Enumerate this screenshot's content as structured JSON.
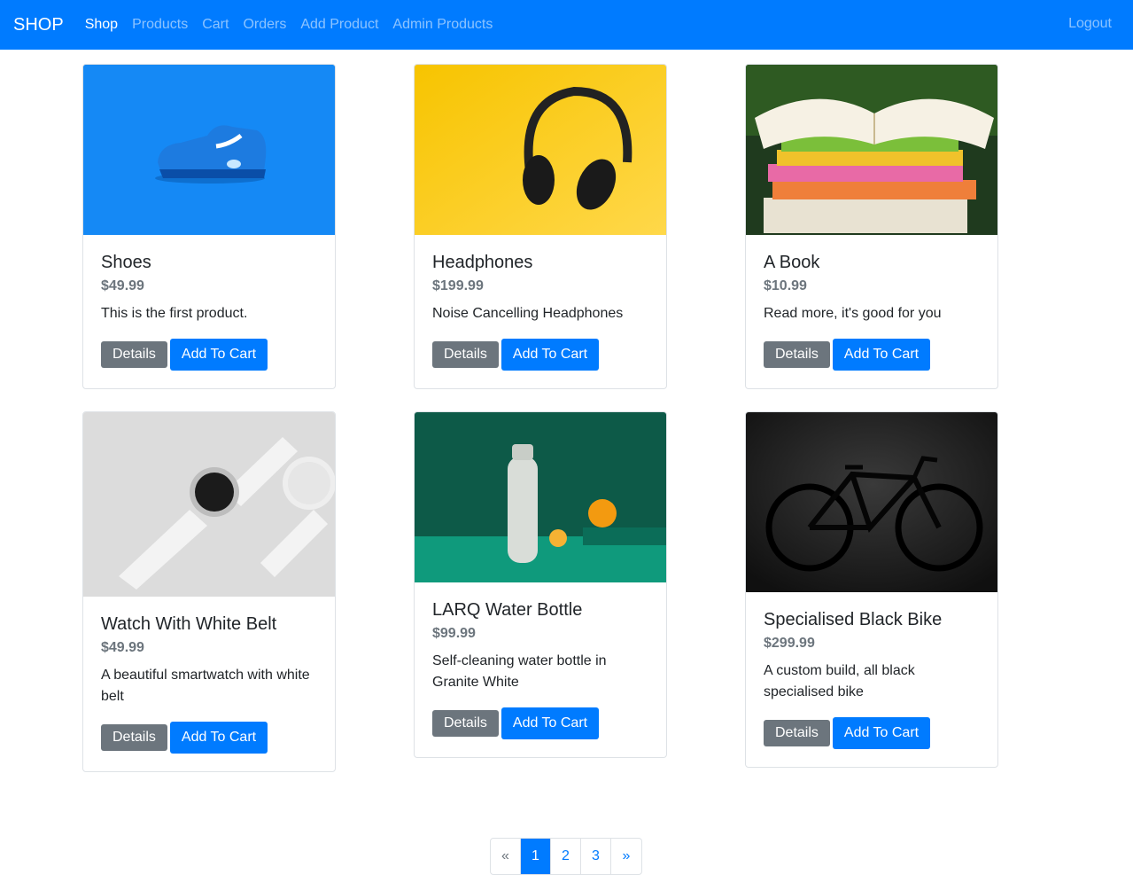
{
  "navbar": {
    "brand": "SHOP",
    "links": [
      {
        "label": "Shop",
        "active": true
      },
      {
        "label": "Products"
      },
      {
        "label": "Cart"
      },
      {
        "label": "Orders"
      },
      {
        "label": "Add Product"
      },
      {
        "label": "Admin Products"
      }
    ],
    "logout": "Logout"
  },
  "products": [
    {
      "title": "Shoes",
      "price": "$49.99",
      "description": "This is the first product.",
      "image": "shoe-image"
    },
    {
      "title": "Headphones",
      "price": "$199.99",
      "description": "Noise Cancelling Headphones",
      "image": "headphones-image"
    },
    {
      "title": "A Book",
      "price": "$10.99",
      "description": "Read more, it's good for you",
      "image": "book-image"
    },
    {
      "title": "Watch With White Belt",
      "price": "$49.99",
      "description": "A beautiful smartwatch with white belt",
      "image": "watch-image"
    },
    {
      "title": "LARQ Water Bottle",
      "price": "$99.99",
      "description": "Self-cleaning water bottle in Granite White",
      "image": "bottle-image"
    },
    {
      "title": "Specialised Black Bike",
      "price": "$299.99",
      "description": "A custom build, all black specialised bike",
      "image": "bike-image"
    }
  ],
  "buttons": {
    "details": "Details",
    "add_to_cart": "Add To Cart"
  },
  "pagination": {
    "prev": "«",
    "pages": [
      "1",
      "2",
      "3"
    ],
    "next": "»",
    "active": "1"
  },
  "colors": {
    "primary": "#007bff",
    "secondary": "#6c757d"
  }
}
